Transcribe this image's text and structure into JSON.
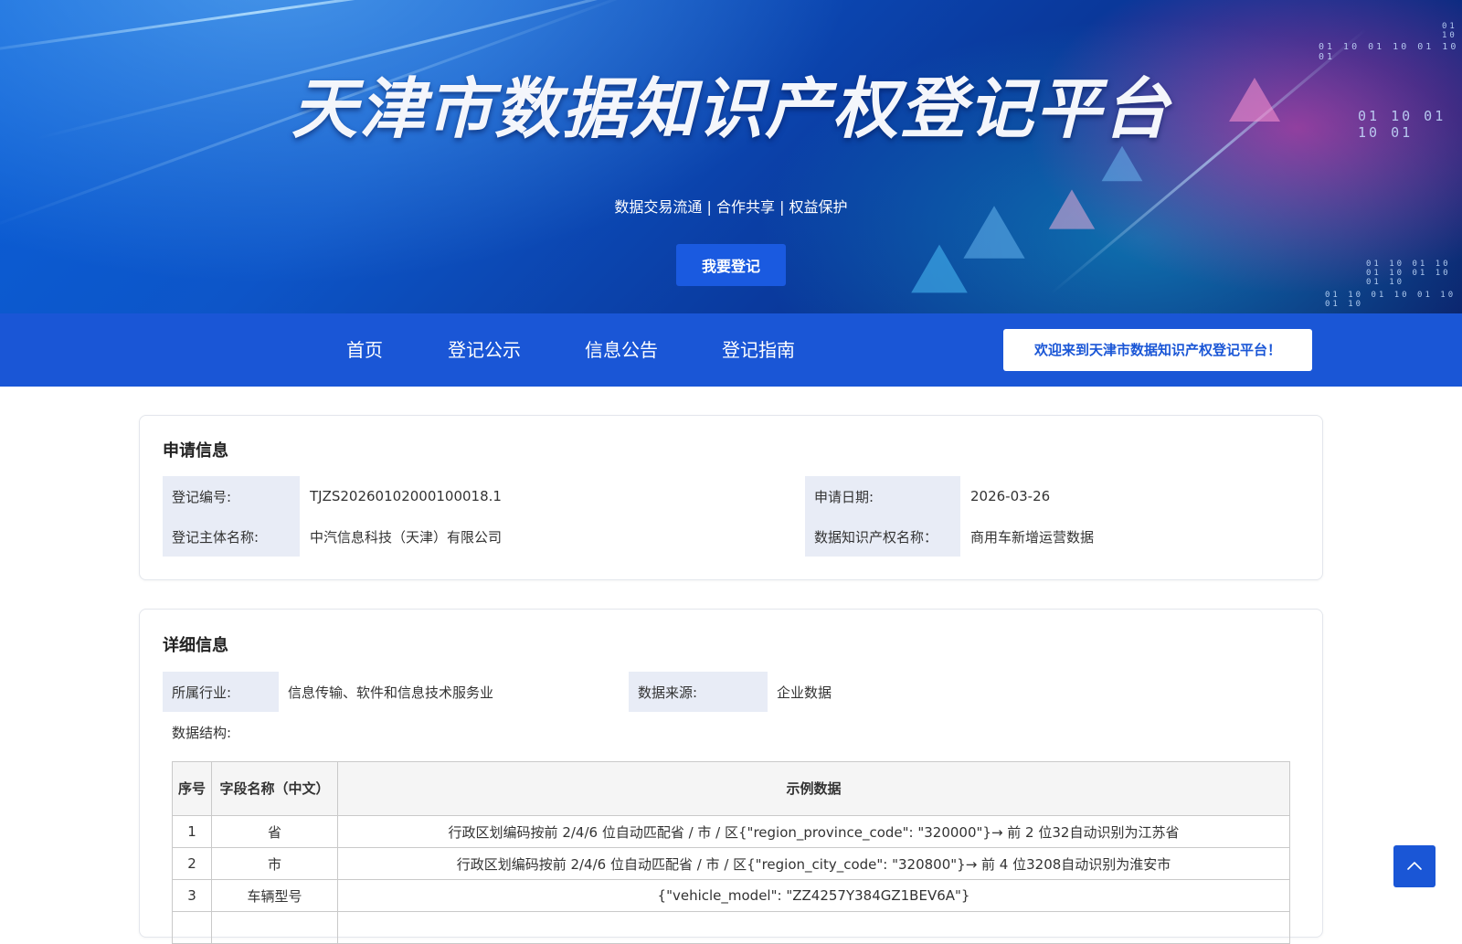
{
  "hero": {
    "title": "天津市数据知识产权登记平台",
    "slogan": "数据交易流通 | 合作共享 | 权益保护",
    "register_label": "我要登记",
    "bits": [
      "01 10 01 10 01 10 01",
      "01 10 01 10 01",
      "01 10 01 10 01 10 01 10 01 10",
      "01 10 01 10 01 10 01 10",
      "01 10"
    ]
  },
  "nav": {
    "items": [
      "首页",
      "登记公示",
      "信息公告",
      "登记指南"
    ],
    "welcome": "欢迎来到天津市数据知识产权登记平台！"
  },
  "application": {
    "title": "申请信息",
    "reg_no_label": "登记编号:",
    "reg_no": "TJZS20260102000100018.1",
    "date_label": "申请日期:",
    "date": "2026-03-26",
    "entity_label": "登记主体名称:",
    "entity": "中汽信息科技（天津）有限公司",
    "ip_name_label": "数据知识产权名称：",
    "ip_name": "商用车新增运营数据"
  },
  "detail": {
    "title": "详细信息",
    "industry_label": "所属行业:",
    "industry": "信息传输、软件和信息技术服务业",
    "source_label": "数据来源:",
    "source": "企业数据",
    "structure_label": "数据结构:",
    "table": {
      "headers": [
        "序号",
        "字段名称（中文）",
        "示例数据"
      ],
      "rows": [
        [
          "1",
          "省",
          "行政区划编码按前 2/4/6 位自动匹配省 / 市 / 区{\"region_province_code\": \"320000\"}→ 前 2 位32自动识别为江苏省"
        ],
        [
          "2",
          "市",
          "行政区划编码按前 2/4/6 位自动匹配省 / 市 / 区{\"region_city_code\": \"320800\"}→ 前 4 位3208自动识别为淮安市"
        ],
        [
          "3",
          "车辆型号",
          "{\"vehicle_model\": \"ZZ4257Y384GZ1BEV6A\"}"
        ],
        [
          "",
          "",
          ""
        ]
      ]
    }
  },
  "icons": {
    "back_to_top": "chevron-up-icon"
  },
  "colors": {
    "primary": "#1a56d6",
    "label_bg": "#e8ecf6"
  }
}
